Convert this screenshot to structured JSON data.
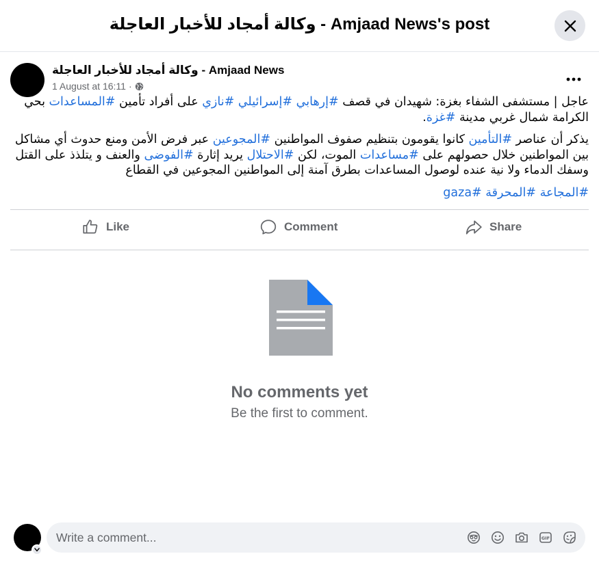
{
  "dialog": {
    "title": "وكالة أمجاد للأخبار العاجلة - Amjaad News's post"
  },
  "post": {
    "author": "وكالة أمجاد للأخبار العاجلة - Amjaad News",
    "timestamp": "1 August at 16:11",
    "separator": "·",
    "audience_icon": "globe-icon",
    "paragraph1": [
      {
        "text": "عاجل | مستشفى الشفاء بغزة: شهيدان في قصف ",
        "tag": false
      },
      {
        "text": "#إرهابي",
        "tag": true
      },
      {
        "text": " ",
        "tag": false
      },
      {
        "text": "#إسرائيلي",
        "tag": true
      },
      {
        "text": " ",
        "tag": false
      },
      {
        "text": "#نازي",
        "tag": true
      },
      {
        "text": " على أفراد تأمين ",
        "tag": false
      },
      {
        "text": "#المساعدات",
        "tag": true
      },
      {
        "text": " بحي الكرامة شمال غربي مدينة ",
        "tag": false
      },
      {
        "text": "#غزة",
        "tag": true
      },
      {
        "text": ".",
        "tag": false
      }
    ],
    "paragraph2": [
      {
        "text": "يذكر أن عناصر ",
        "tag": false
      },
      {
        "text": "#التأمين",
        "tag": true
      },
      {
        "text": " كانوا يقومون بتنظيم صفوف المواطنين ",
        "tag": false
      },
      {
        "text": "#المجوعين",
        "tag": true
      },
      {
        "text": " عبر فرض الأمن ومنع حدوث أي مشاكل بين المواطنين خلال حصولهم على ",
        "tag": false
      },
      {
        "text": "#مساعدات",
        "tag": true
      },
      {
        "text": " الموت، لكن ",
        "tag": false
      },
      {
        "text": "#الاحتلال",
        "tag": true
      },
      {
        "text": " يريد إثارة ",
        "tag": false
      },
      {
        "text": "#الفوضى",
        "tag": true
      },
      {
        "text": " والعنف و يتلذذ على القتل وسفك الدماء ولا نية عنده لوصول المساعدات بطرق آمنة إلى المواطنين المجوعين في القطاع",
        "tag": false
      }
    ],
    "paragraph3": [
      {
        "text": "#المجاعة",
        "tag": true
      },
      {
        "text": " ",
        "tag": false
      },
      {
        "text": "#المحرقة",
        "tag": true
      },
      {
        "text": " ",
        "tag": false
      },
      {
        "text": "#gaza",
        "tag": true
      }
    ]
  },
  "actions": {
    "like": "Like",
    "comment": "Comment",
    "share": "Share"
  },
  "empty_state": {
    "title": "No comments yet",
    "subtitle": "Be the first to comment."
  },
  "composer": {
    "placeholder": "Write a comment...",
    "tools": [
      "avatar-sticker-icon",
      "emoji-icon",
      "camera-icon",
      "gif-icon",
      "sticker-icon"
    ]
  },
  "colors": {
    "hashtag": "#216fdb",
    "secondary_text": "#65676b",
    "document_fold": "#1877f2"
  }
}
